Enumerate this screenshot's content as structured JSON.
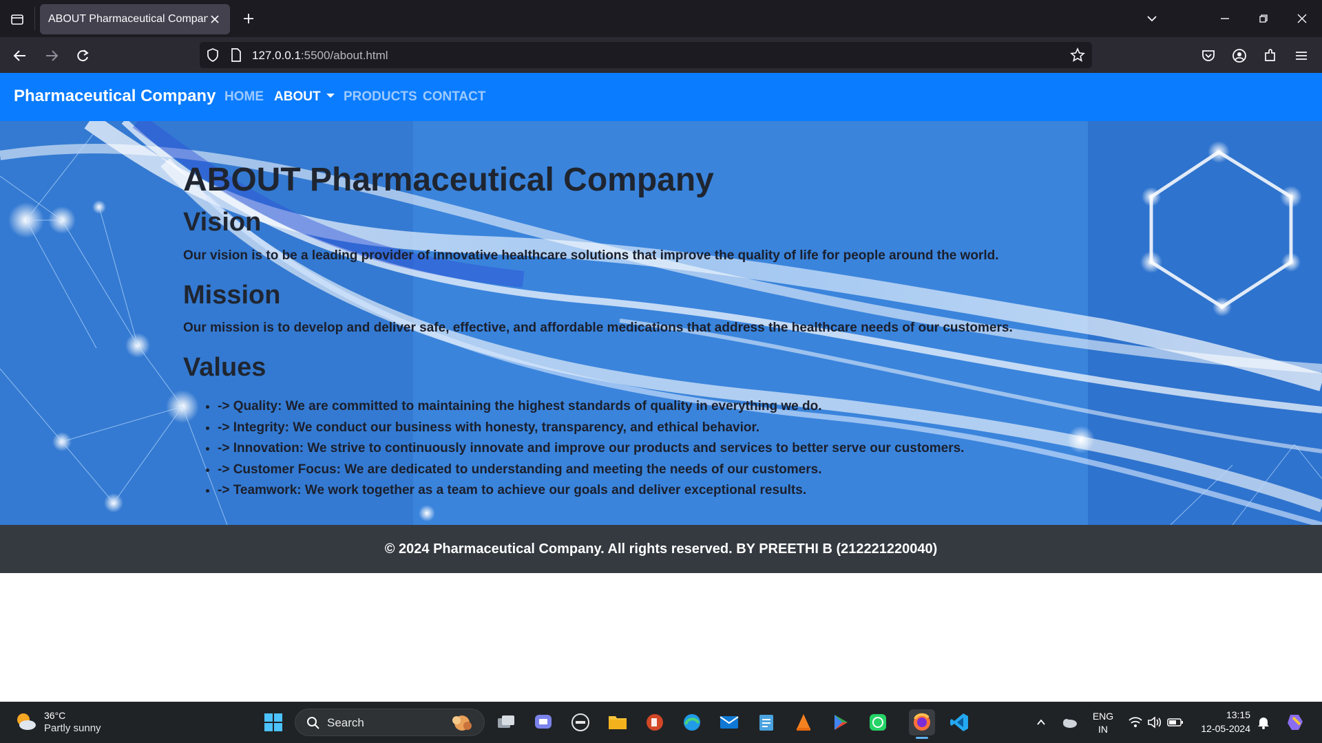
{
  "browser": {
    "tab_title": "ABOUT Pharmaceutical Company",
    "url_host": "127.0.0.1",
    "url_rest": ":5500/about.html"
  },
  "site": {
    "brand": "Pharmaceutical Company",
    "nav": {
      "home": "HOME",
      "about": "ABOUT",
      "products": "PRODUCTS",
      "contact": "CONTACT"
    },
    "heading": "ABOUT Pharmaceutical Company",
    "vision_title": "Vision",
    "vision_text": "Our vision is to be a leading provider of innovative healthcare solutions that improve the quality of life for people around the world.",
    "mission_title": "Mission",
    "mission_text": "Our mission is to develop and deliver safe, effective, and affordable medications that address the healthcare needs of our customers.",
    "values_title": "Values",
    "values": [
      "-> Quality: We are committed to maintaining the highest standards of quality in everything we do.",
      "-> Integrity: We conduct our business with honesty, transparency, and ethical behavior.",
      "-> Innovation: We strive to continuously innovate and improve our products and services to better serve our customers.",
      "-> Customer Focus: We are dedicated to understanding and meeting the needs of our customers.",
      "-> Teamwork: We work together as a team to achieve our goals and deliver exceptional results."
    ],
    "footer": "© 2024 Pharmaceutical Company. All rights reserved. BY PREETHI B (212221220040)"
  },
  "taskbar": {
    "weather_temp": "36°C",
    "weather_desc": "Partly sunny",
    "search_label": "Search",
    "lang_line1": "ENG",
    "lang_line2": "IN",
    "time": "13:15",
    "date": "12-05-2024"
  }
}
